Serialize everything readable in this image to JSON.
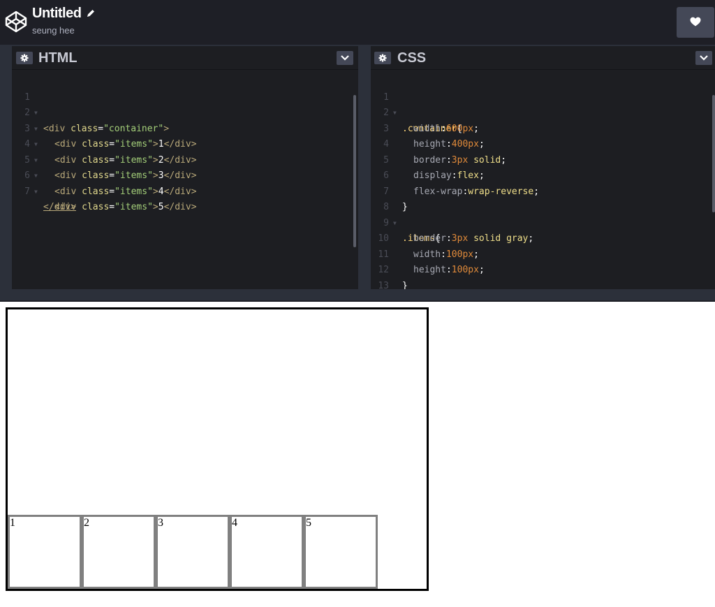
{
  "header": {
    "title": "Untitled",
    "author": "seung hee"
  },
  "html_pane": {
    "title": "HTML",
    "lines": [
      {
        "n": "1",
        "fold": true
      },
      {
        "n": "2",
        "fold": true
      },
      {
        "n": "3",
        "fold": true
      },
      {
        "n": "4",
        "fold": true
      },
      {
        "n": "5",
        "fold": true
      },
      {
        "n": "6",
        "fold": true
      },
      {
        "n": "7",
        "fold": false
      }
    ],
    "code": {
      "l1": {
        "t1": "<div ",
        "a1": "class",
        "e1": "=",
        "s1": "\"container\"",
        "t2": ">"
      },
      "l2": {
        "t1": "<div ",
        "a1": "class",
        "e1": "=",
        "s1": "\"items\"",
        "t2": ">",
        "x": "1",
        "t3": "</div>"
      },
      "l3": {
        "t1": "<div ",
        "a1": "class",
        "e1": "=",
        "s1": "\"items\"",
        "t2": ">",
        "x": "2",
        "t3": "</div>"
      },
      "l4": {
        "t1": "<div ",
        "a1": "class",
        "e1": "=",
        "s1": "\"items\"",
        "t2": ">",
        "x": "3",
        "t3": "</div>"
      },
      "l5": {
        "t1": "<div ",
        "a1": "class",
        "e1": "=",
        "s1": "\"items\"",
        "t2": ">",
        "x": "4",
        "t3": "</div>"
      },
      "l6": {
        "t1": "<div ",
        "a1": "class",
        "e1": "=",
        "s1": "\"items\"",
        "t2": ">",
        "x": "5",
        "t3": "</div>"
      },
      "l7": {
        "t1": "</div>"
      }
    }
  },
  "css_pane": {
    "title": "CSS",
    "lines": [
      "1",
      "2",
      "3",
      "4",
      "5",
      "6",
      "7",
      "8",
      "9",
      "10",
      "11",
      "12",
      "13"
    ],
    "code": {
      "l1": {
        "sel": ".container",
        "p": "{"
      },
      "l2": {
        "prop": "width",
        "c": ":",
        "num": "600px",
        "e": ";"
      },
      "l3": {
        "prop": "height",
        "c": ":",
        "num": "400px",
        "e": ";"
      },
      "l4": {
        "prop": "border",
        "c": ":",
        "num": "3px",
        "val": " solid",
        "e": ";"
      },
      "l5": {
        "prop": "display",
        "c": ":",
        "val": "flex",
        "e": ";"
      },
      "l6": {
        "prop": "flex-wrap",
        "c": ":",
        "val": "wrap-reverse",
        "e": ";"
      },
      "l7": {
        "p": "}"
      },
      "l8": {
        "sel": ".items",
        "p": "{"
      },
      "l9": {
        "prop": "border",
        "c": ":",
        "num": "3px",
        "val": " solid gray",
        "e": ";"
      },
      "l10": {
        "prop": "width",
        "c": ":",
        "num": "100px",
        "e": ";"
      },
      "l11": {
        "prop": "height",
        "c": ":",
        "num": "100px",
        "e": ";"
      },
      "l12": {
        "p": "}"
      }
    }
  },
  "preview": {
    "items": [
      "1",
      "2",
      "3",
      "4",
      "5"
    ]
  },
  "colors": {
    "header_bg": "#1e1f26",
    "editor_bg": "#1d1e22",
    "button_bg": "#444857"
  }
}
